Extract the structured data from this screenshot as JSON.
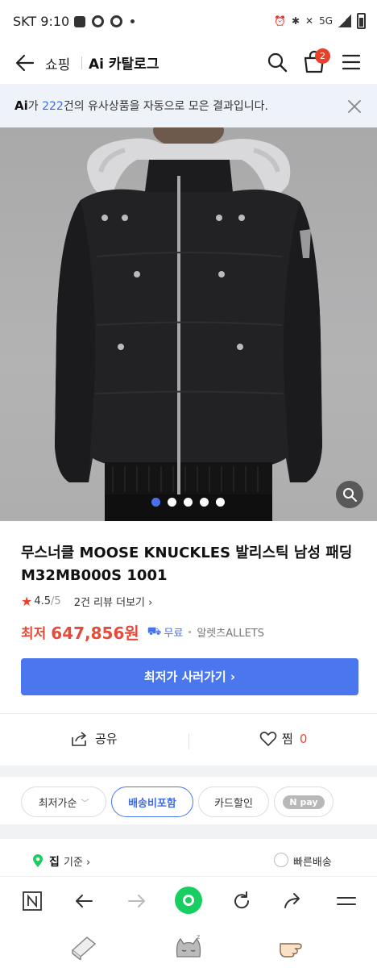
{
  "status_bar": {
    "carrier_time": "SKT 9:10",
    "network": "5G"
  },
  "header": {
    "shop_label": "쇼핑",
    "catalog_label": "Ai 카탈로그",
    "cart_count": "2"
  },
  "ai_banner": {
    "ai_mark": "Ai",
    "prefix": "가 ",
    "count": "222",
    "suffix": "건의 유사상품을 자동으로 모은 결과입니다."
  },
  "gallery": {
    "slide_count": 5,
    "active_index": 0
  },
  "product": {
    "title": "무스너클 MOOSE KNUCKLES 발리스틱 남성 패딩 M32MB000S 1001",
    "rating": "4.5",
    "rating_max": "/5",
    "reviews": "2건 리뷰 더보기",
    "price_label": "최저",
    "price": "647,856원",
    "shipping": "무료",
    "seller": "알렛츠ALLETS",
    "buy_button": "최저가 사러가기"
  },
  "actions": {
    "share_label": "공유",
    "like_label": "찜",
    "like_count": "0"
  },
  "filters": {
    "chips": [
      "최저가순",
      "배송비포함",
      "카드할인",
      "pay"
    ]
  },
  "location": {
    "label": "집",
    "basis": "기준",
    "fast_shipping": "빠른배송"
  },
  "colors": {
    "accent": "#4a76ee",
    "price": "#e54a3a",
    "naver_green": "#19ce60",
    "badge": "#e8412b"
  },
  "icons": [
    "back-arrow-icon",
    "search-icon",
    "cart-icon",
    "menu-icon",
    "close-icon",
    "zoom-icon",
    "star-icon",
    "truck-icon",
    "share-icon",
    "heart-icon",
    "pin-icon",
    "check-icon",
    "naver-n-icon",
    "forward-arrow-icon",
    "refresh-icon",
    "share-arrow-icon"
  ]
}
